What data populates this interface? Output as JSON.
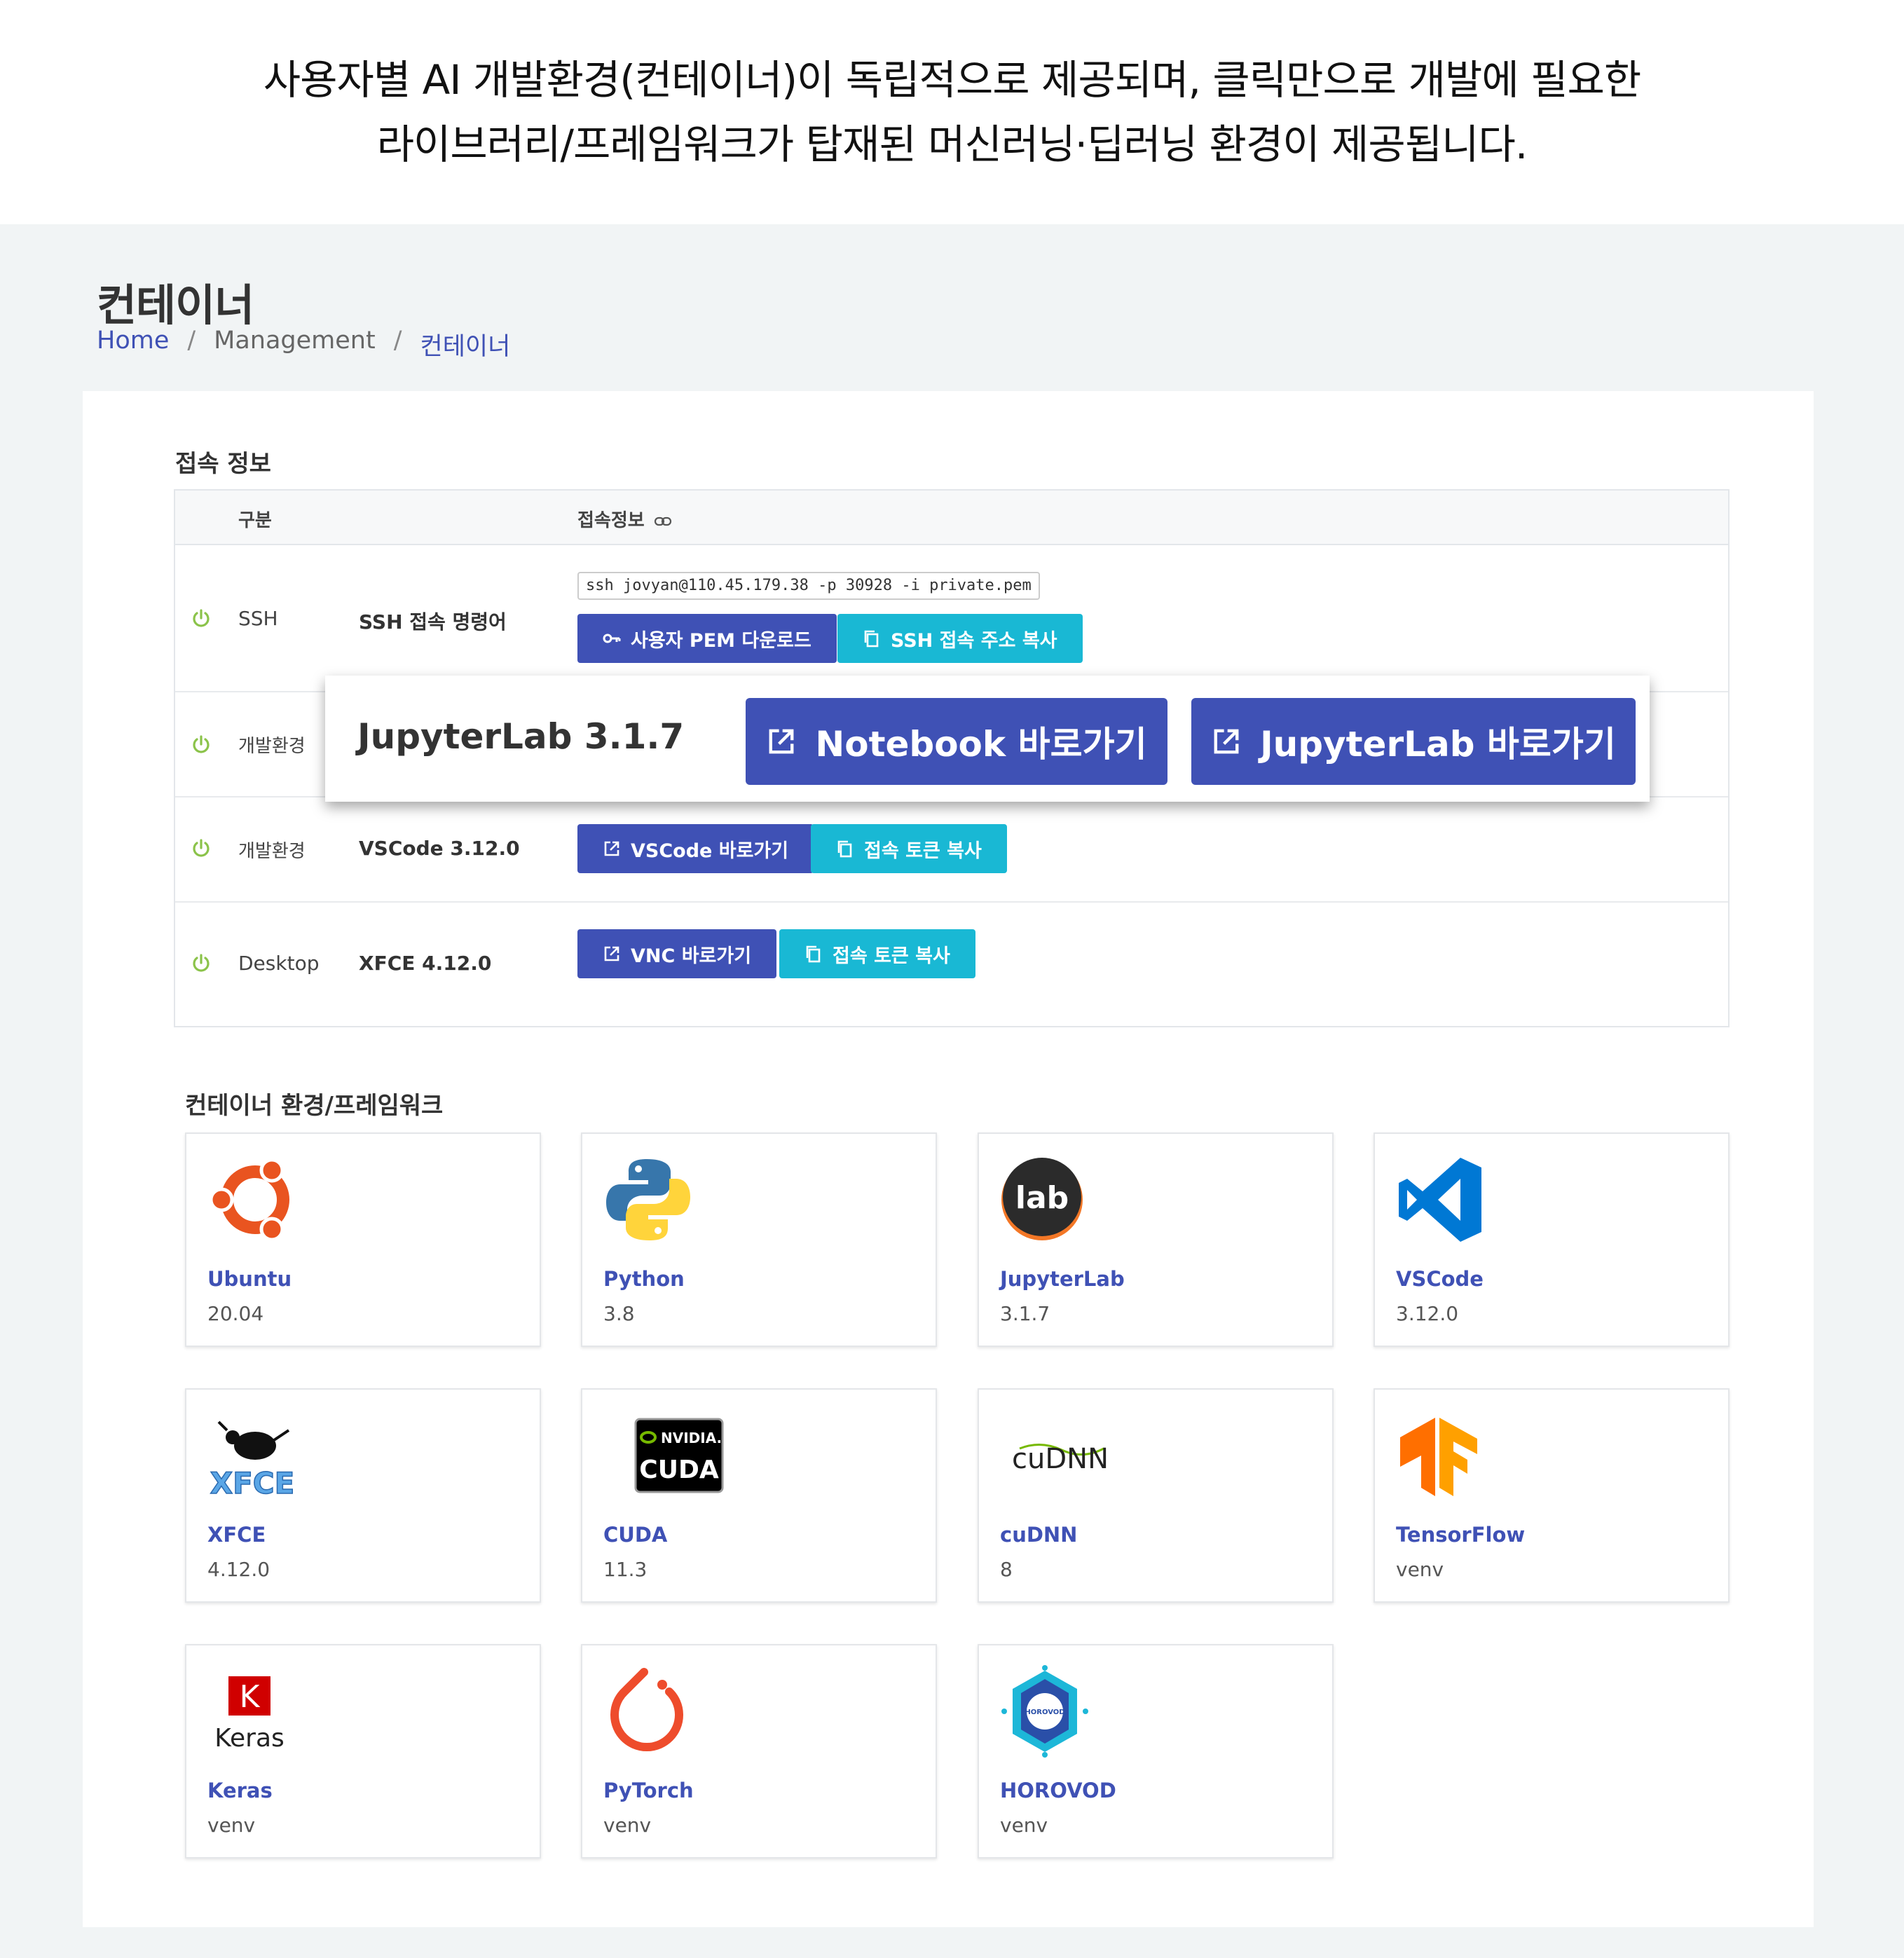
{
  "headline": {
    "line1": "사용자별 AI 개발환경(컨테이너)이 독립적으로 제공되며, 클릭만으로 개발에 필요한",
    "line2": "라이브러리/프레임워크가 탑재된 머신러닝·딥러닝 환경이 제공됩니다."
  },
  "page": {
    "title": "컨테이너",
    "breadcrumb": {
      "home": "Home",
      "sep": "/",
      "management": "Management",
      "current": "컨테이너"
    }
  },
  "connection": {
    "title": "접속 정보",
    "headers": {
      "type": "구분",
      "info": "접속정보"
    },
    "rows": [
      {
        "type": "SSH",
        "detail": "SSH 접속 명령어",
        "command": "ssh jovyan@110.45.179.38 -p 30928 -i private.pem",
        "button1": "사용자 PEM 다운로드",
        "button2": "SSH 접속 주소 복사"
      },
      {
        "type": "개발환경",
        "detail": "JupyterLab 3.1.7",
        "button1": "Notebook 바로가기",
        "button2": "JupyterLab 바로가기"
      },
      {
        "type": "개발환경",
        "detail": "VSCode 3.12.0",
        "button1": "VSCode 바로가기",
        "button2": "접속 토큰 복사"
      },
      {
        "type": "Desktop",
        "detail": "XFCE 4.12.0",
        "button1": "VNC 바로가기",
        "button2": "접속 토큰 복사"
      }
    ]
  },
  "frameworks": {
    "title": "컨테이너 환경/프레임워크",
    "items": [
      {
        "name": "Ubuntu",
        "version": "20.04",
        "icon": "ubuntu-icon"
      },
      {
        "name": "Python",
        "version": "3.8",
        "icon": "python-icon"
      },
      {
        "name": "JupyterLab",
        "version": "3.1.7",
        "icon": "jupyterlab-icon",
        "logo_text": "lab"
      },
      {
        "name": "VSCode",
        "version": "3.12.0",
        "icon": "vscode-icon"
      },
      {
        "name": "XFCE",
        "version": "4.12.0",
        "icon": "xfce-icon",
        "logo_text": "XFCE"
      },
      {
        "name": "CUDA",
        "version": "11.3",
        "icon": "nvidia-cuda-icon",
        "logo_text": "CUDA",
        "logo_brand": "NVIDIA."
      },
      {
        "name": "cuDNN",
        "version": "8",
        "icon": "cudnn-icon",
        "logo_text": "cuDNN"
      },
      {
        "name": "TensorFlow",
        "version": "venv",
        "icon": "tensorflow-icon"
      },
      {
        "name": "Keras",
        "version": "venv",
        "icon": "keras-icon",
        "logo_letter": "K",
        "logo_text": "Keras"
      },
      {
        "name": "PyTorch",
        "version": "venv",
        "icon": "pytorch-icon"
      },
      {
        "name": "HOROVOD",
        "version": "venv",
        "icon": "horovod-icon",
        "logo_text": "HOROVOD"
      }
    ]
  },
  "colors": {
    "primary": "#3f51b5",
    "info": "#19b8d4",
    "status_green": "#8bc34a",
    "background": "#f1f4f5"
  }
}
